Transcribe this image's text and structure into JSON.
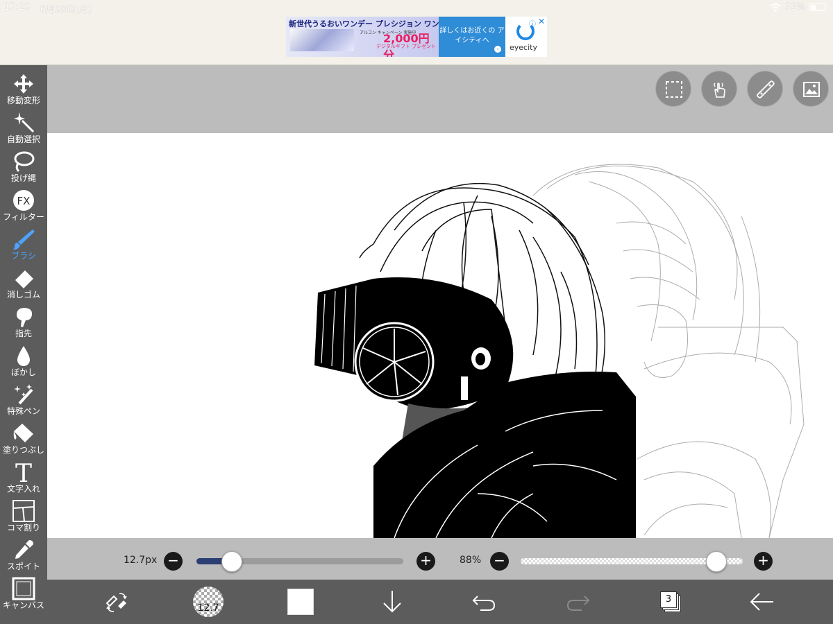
{
  "status": {
    "time": "17:29",
    "date": "6月28日(月)",
    "battery": "33%"
  },
  "ad": {
    "headline": "新世代うるおいワンデー プレシジョン ワン",
    "campaign": "アルコン キャンペーン 実施中",
    "price": "2,000円分",
    "gift": "デジタルギフト プレゼント",
    "cta": "詳しくはお近くの アイシティへ",
    "brand": "eyecity"
  },
  "tools": [
    {
      "label": "移動変形",
      "icon": "move-icon"
    },
    {
      "label": "自動選択",
      "icon": "magic-wand-icon"
    },
    {
      "label": "投げ縄",
      "icon": "lasso-icon"
    },
    {
      "label": "フィルター",
      "icon": "fx-icon"
    },
    {
      "label": "ブラシ",
      "icon": "brush-icon",
      "active": true
    },
    {
      "label": "消しゴム",
      "icon": "eraser-icon"
    },
    {
      "label": "指先",
      "icon": "finger-icon"
    },
    {
      "label": "ぼかし",
      "icon": "blur-drop-icon"
    },
    {
      "label": "特殊ペン",
      "icon": "special-pen-icon"
    },
    {
      "label": "塗りつぶし",
      "icon": "bucket-icon"
    },
    {
      "label": "文字入れ",
      "icon": "text-icon"
    },
    {
      "label": "コマ割り",
      "icon": "frame-divider-icon"
    },
    {
      "label": "スポイト",
      "icon": "eyedropper-icon"
    },
    {
      "label": "キャンバス",
      "icon": "canvas-icon"
    }
  ],
  "brush": {
    "size_label": "12.7px",
    "size_fraction": 0.17,
    "opacity_label": "88%",
    "opacity_fraction": 0.88
  },
  "bottom": {
    "brush_size": "12.7",
    "layer_count": "3"
  },
  "colors": {
    "accent": "#4da3ff",
    "toolbar": "#5c5c5c",
    "workspace": "#bcbcbc",
    "slider_fill": "#2b3f74"
  }
}
